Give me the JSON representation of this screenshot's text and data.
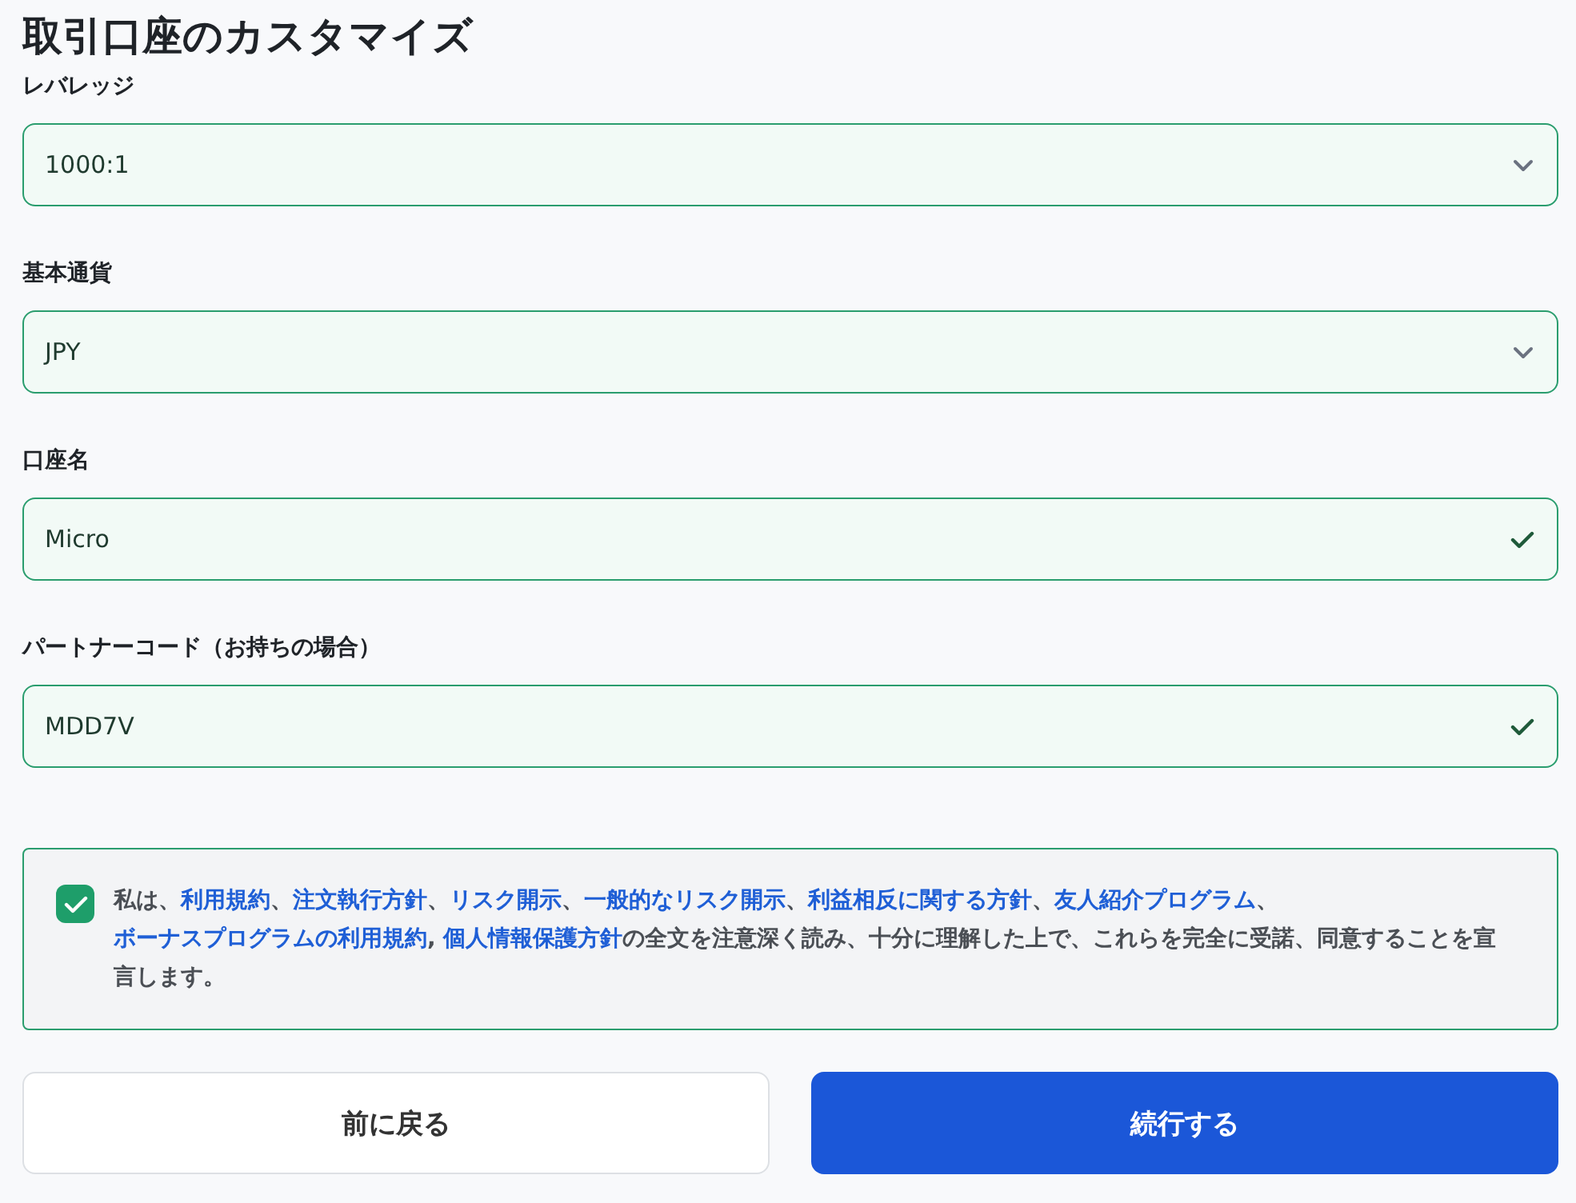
{
  "title": "取引口座のカスタマイズ",
  "fields": [
    {
      "label": "レバレッジ",
      "kind": "select",
      "value": "1000:1"
    },
    {
      "label": "基本通貨",
      "kind": "select",
      "value": "JPY"
    },
    {
      "label": "口座名",
      "kind": "text",
      "value": "Micro",
      "valid": true
    },
    {
      "label": "パートナーコード（お持ちの場合）",
      "kind": "text",
      "value": "MDD7V",
      "valid": true
    }
  ],
  "consent": {
    "checked": true,
    "segments": [
      {
        "kind": "text",
        "text": "私は、"
      },
      {
        "kind": "link",
        "text": "利用規約"
      },
      {
        "kind": "text",
        "text": "、"
      },
      {
        "kind": "link",
        "text": "注文執行方針"
      },
      {
        "kind": "text",
        "text": "、"
      },
      {
        "kind": "link",
        "text": "リスク開示"
      },
      {
        "kind": "text",
        "text": "、"
      },
      {
        "kind": "link",
        "text": "一般的なリスク開示"
      },
      {
        "kind": "text",
        "text": "、"
      },
      {
        "kind": "link",
        "text": "利益相反に関する方針"
      },
      {
        "kind": "text",
        "text": "、"
      },
      {
        "kind": "link",
        "text": "友人紹介プログラム"
      },
      {
        "kind": "text",
        "text": "、"
      },
      {
        "kind": "link",
        "text": "ボーナスプログラムの利用規約"
      },
      {
        "kind": "text",
        "text": ", "
      },
      {
        "kind": "link",
        "text": "個人情報保護方針"
      },
      {
        "kind": "text",
        "text": "の全文を注意深く読み、十分に理解した上で、これらを完全に受諾、同意することを宣言します。"
      }
    ]
  },
  "buttons": [
    {
      "label": "前に戻る",
      "kind": "secondary"
    },
    {
      "label": "続行する",
      "kind": "primary"
    }
  ]
}
